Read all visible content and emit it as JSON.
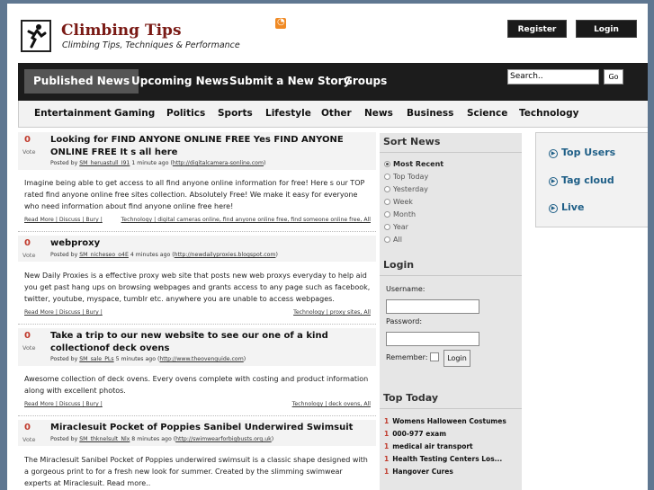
{
  "header": {
    "site_title": "Climbing Tips",
    "tagline": "Climbing Tips, Techniques & Performance",
    "register_label": "Register",
    "login_label": "Login"
  },
  "nav": {
    "items": [
      "Published News",
      "Upcoming News",
      "Submit a New Story",
      "Groups"
    ],
    "search_value": "Search..",
    "go_label": "Go"
  },
  "categories": [
    "Entertainment",
    "Gaming",
    "Politics",
    "Sports",
    "Lifestyle",
    "Other",
    "News",
    "Business",
    "Science",
    "Technology"
  ],
  "stories": [
    {
      "votes": "0",
      "vote_label": "Vote",
      "title": "Looking for FIND ANYONE ONLINE FREE Yes FIND ANYONE ONLINE FREE It s all here",
      "meta_prefix": "Posted by ",
      "author": "SM_heruastull_I91",
      "time": " 1 minute ago (",
      "url": "http://digitalcamera-sonline.com",
      "meta_suffix": ")",
      "body": "Imagine being able to get access to all find anyone online information for free! Here s our TOP rated find anyone online free sites collection. Absolutely Free! We make it easy for everyone who need information about find anyone online free here!",
      "links": "Read More | Discuss | Bury |",
      "tags": "Technology | digital cameras online, find anyone online free, find someone online free, All"
    },
    {
      "votes": "0",
      "vote_label": "Vote",
      "title": "webproxy",
      "meta_prefix": "Posted by ",
      "author": "SM_nicheseo_o4E",
      "time": " 4 minutes ago (",
      "url": "http://newdailyproxies.blogspot.com",
      "meta_suffix": ")",
      "body": "New Daily Proxies is a effective proxy web site that posts new web proxys everyday to help aid you get past hang ups on browsing webpages and grants access to any page such as facebook, twitter, youtube, myspace, tumblr etc. anywhere you are unable to access webpages.",
      "links": "Read More | Discuss | Bury |",
      "tags": "Technology | proxy sites, All"
    },
    {
      "votes": "0",
      "vote_label": "Vote",
      "title": "Take a trip to our new website to see our one of a kind collectionof deck ovens",
      "meta_prefix": "Posted by ",
      "author": "SM_sale_PLs",
      "time": " 5 minutes ago (",
      "url": "http://www.theovenguide.com",
      "meta_suffix": ")",
      "body": "Awesome collection of deck ovens. Every ovens complete with costing and product information along with excellent photos.",
      "links": "Read More | Discuss | Bury |",
      "tags": "Technology | deck ovens, All"
    },
    {
      "votes": "0",
      "vote_label": "Vote",
      "title": "Miraclesuit Pocket of Poppies Sanibel Underwired Swimsuit",
      "meta_prefix": "Posted by ",
      "author": "SM_thknelsult_Nlx",
      "time": " 8 minutes ago (",
      "url": "http://swimwearforbigbusts.org.uk",
      "meta_suffix": ")",
      "body": "The Miraclesuit Sanibel Pocket of Poppies underwired swimsuit is a classic shape designed with a gorgeous print to for a fresh new look for summer. Created by the slimming swimwear experts at Miraclesuit. Read more..",
      "links": "",
      "tags": ""
    }
  ],
  "sort_news": {
    "heading": "Sort News",
    "options": [
      "Most Recent",
      "Top Today",
      "Yesterday",
      "Week",
      "Month",
      "Year",
      "All"
    ],
    "selected": "Most Recent"
  },
  "login_box": {
    "heading": "Login",
    "username_label": "Username:",
    "password_label": "Password:",
    "remember_label": "Remember:",
    "button_label": "Login"
  },
  "top_today": {
    "heading": "Top Today",
    "items": [
      {
        "n": "1",
        "label": "Womens Halloween Costumes"
      },
      {
        "n": "1",
        "label": "000-977 exam"
      },
      {
        "n": "1",
        "label": "medical air transport"
      },
      {
        "n": "1",
        "label": "Health Testing Centers Los..."
      },
      {
        "n": "1",
        "label": "Hangover Cures"
      }
    ]
  },
  "right_links": [
    "Top Users",
    "Tag cloud",
    "Live"
  ]
}
